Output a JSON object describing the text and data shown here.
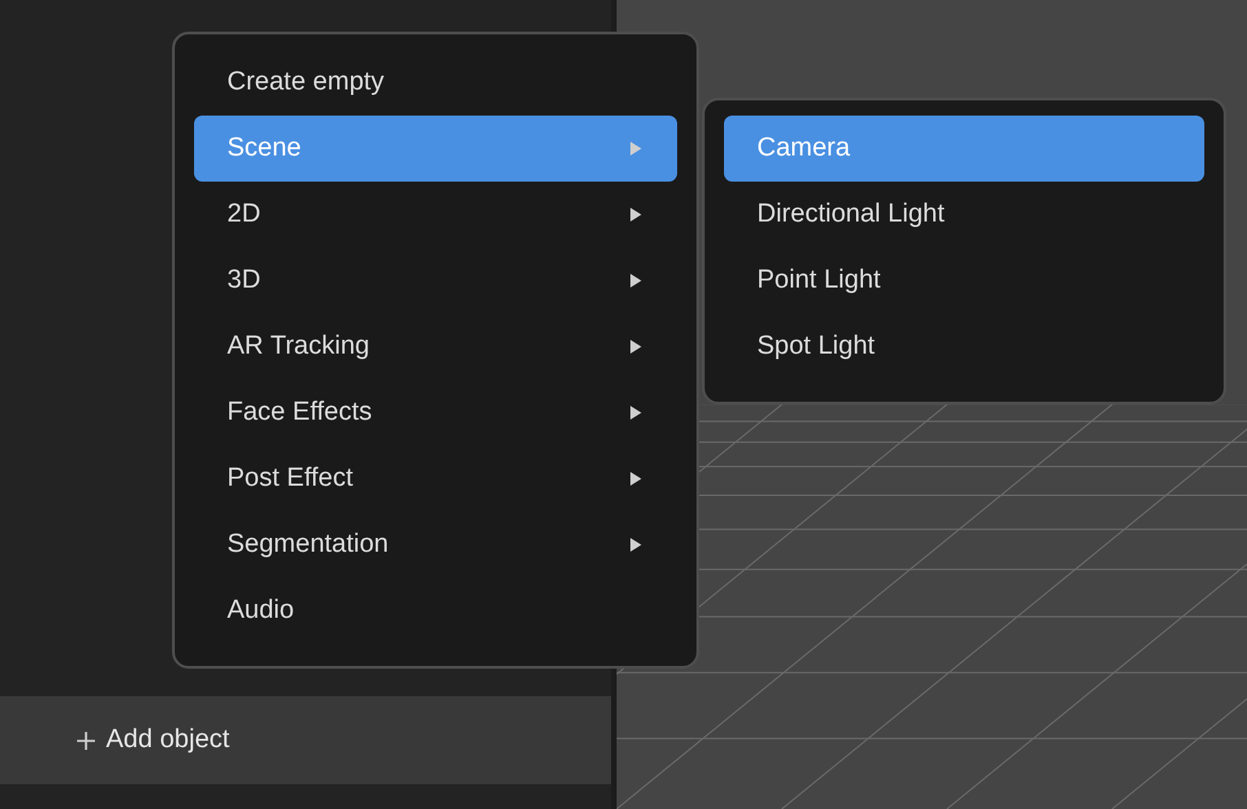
{
  "menu": {
    "items": [
      {
        "label": "Create empty",
        "selected": false,
        "has_submenu": false
      },
      {
        "label": "Scene",
        "selected": true,
        "has_submenu": true
      },
      {
        "label": "2D",
        "selected": false,
        "has_submenu": true
      },
      {
        "label": "3D",
        "selected": false,
        "has_submenu": true
      },
      {
        "label": "AR Tracking",
        "selected": false,
        "has_submenu": true
      },
      {
        "label": "Face Effects",
        "selected": false,
        "has_submenu": true
      },
      {
        "label": "Post Effect",
        "selected": false,
        "has_submenu": true
      },
      {
        "label": "Segmentation",
        "selected": false,
        "has_submenu": true
      },
      {
        "label": "Audio",
        "selected": false,
        "has_submenu": false
      }
    ]
  },
  "submenu": {
    "items": [
      {
        "label": "Camera",
        "selected": true
      },
      {
        "label": "Directional Light",
        "selected": false
      },
      {
        "label": "Point Light",
        "selected": false
      },
      {
        "label": "Spot Light",
        "selected": false
      }
    ]
  },
  "add_button": {
    "label": "Add object"
  }
}
